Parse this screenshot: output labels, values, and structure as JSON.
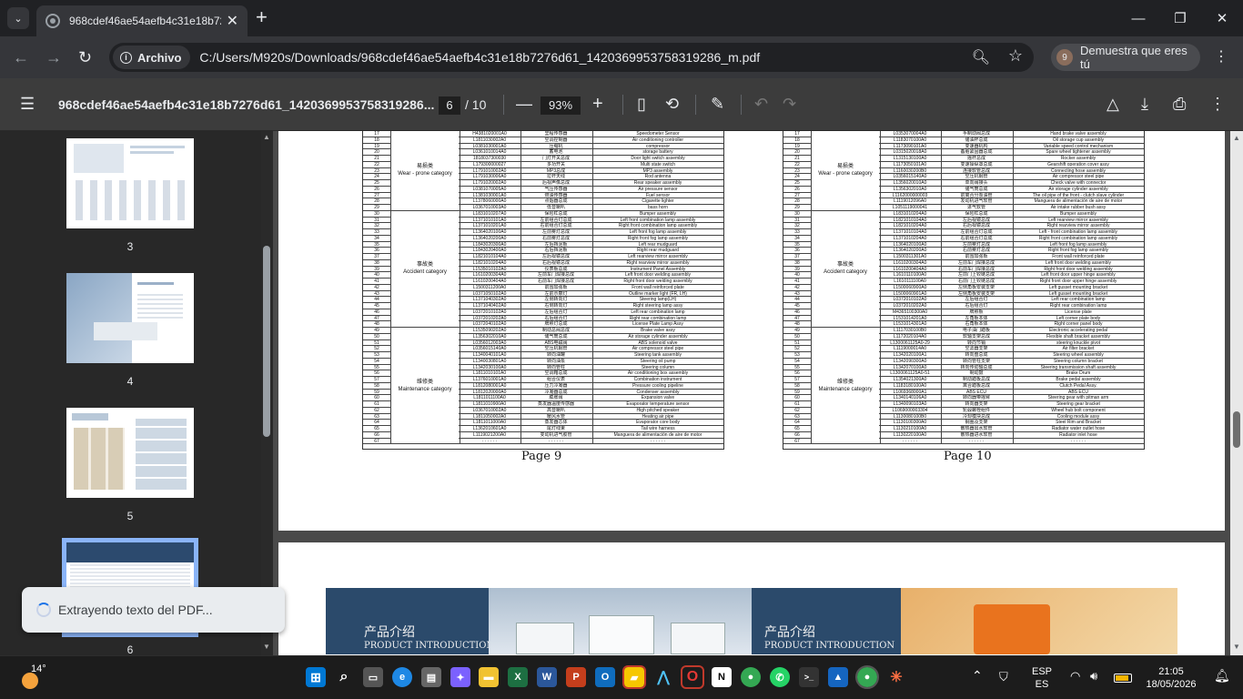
{
  "browser": {
    "tab_title": "968cdef46ae54aefb4c31e18b72",
    "address_chip": "Archivo",
    "url": "C:/Users/M920s/Downloads/968cdef46ae54aefb4c31e18b7276d61_1420369953758319286_m.pdf",
    "profile_label": "Demuestra que eres tú",
    "profile_initial": "9"
  },
  "pdf_toolbar": {
    "title": "968cdef46ae54aefb4c31e18b7276d61_1420369953758319286...",
    "current_page": "6",
    "total_pages": "/ 10",
    "zoom": "93%"
  },
  "thumbnails": [
    {
      "number": "3",
      "selected": false
    },
    {
      "number": "4",
      "selected": false
    },
    {
      "number": "5",
      "selected": false
    },
    {
      "number": "6",
      "selected": true
    }
  ],
  "toast": {
    "text": "Extrayendo texto del PDF..."
  },
  "page9": {
    "label": "Page  9",
    "categories": [
      {
        "zh": "易损类",
        "en": "Wear - prone category"
      },
      {
        "zh": "事故类",
        "en": "Accident category"
      },
      {
        "zh": "维修类",
        "en": "Maintenance category"
      }
    ],
    "rows": [
      [
        "17",
        "H4381020001A0",
        "里程传感器",
        "Speedometer Sensor"
      ],
      [
        "18",
        "L1811030002A0",
        "空调控制器",
        "Air conditioning controller"
      ],
      [
        "19",
        "L0381030001A0",
        "压缩机",
        "compressor"
      ],
      [
        "20",
        "L0361010014A0",
        "蓄电池",
        "storage battery"
      ],
      [
        "21",
        "1818037300030",
        "门灯开关总成",
        "Door light switch assembly"
      ],
      [
        "22",
        "L179300000027",
        "多功开关",
        "Multi state switch"
      ],
      [
        "23",
        "L1791010002A0",
        "MP3总成",
        "MP3 assembly"
      ],
      [
        "24",
        "L1791030006A0",
        "拉杆天线",
        "Rod antenna"
      ],
      [
        "25",
        "L1791020002A0",
        "后视声像总成",
        "Rear speaker assembly"
      ],
      [
        "26",
        "L0381070005A0",
        "气压传感器",
        "Air pressure sensor"
      ],
      [
        "27",
        "L1381030001A0",
        "燃油传感器",
        "Fuel sensor"
      ],
      [
        "28",
        "L1378060000A0",
        "点烟器总成",
        "Cigarette lighter"
      ],
      [
        "29",
        "L0367010003A0",
        "低音喇叭",
        "bass horn"
      ],
      [
        "30",
        "L1831010207A0",
        "保险杠总成",
        "Bumper assembly"
      ],
      [
        "31",
        "L1371010101A0",
        "左前组合灯总成",
        "Left front combination lamp assembly"
      ],
      [
        "32",
        "L1371010201A0",
        "右前组合灯总成",
        "Right front combination lamp assembly"
      ],
      [
        "33",
        "L1364020100A0",
        "左前雾灯总成",
        "Left front fog lamp assembly"
      ],
      [
        "34",
        "L1364020200A0",
        "右前雾灯总成",
        "Right front fog lamp assembly"
      ],
      [
        "35",
        "L1843020300A0",
        "左后挡泥板",
        "Left rear mudguard"
      ],
      [
        "36",
        "L1843020400A0",
        "右后挡泥板",
        "Right rear mudguard"
      ],
      [
        "37",
        "L1821010104A0",
        "左后视镜总成",
        "Left rearview mirror assembly"
      ],
      [
        "38",
        "L1821010204A0",
        "右后视镜总成",
        "Right rearview mirror assembly"
      ],
      [
        "39",
        "L1535010102A0",
        "仪表板总成",
        "Instrument Panel Assembly"
      ],
      [
        "40",
        "L1610200304A0",
        "左前车门焊接总成",
        "Left front door welding assembly"
      ],
      [
        "41",
        "L1610200404A0",
        "右前车门焊接总成",
        "Right front door welding assembly"
      ],
      [
        "42",
        "L1500311200A0",
        "前围加强板",
        "Front wall reinforced plate"
      ],
      [
        "43",
        "L0371050102A0",
        "左前示廓灯",
        "Outline marker light (FR, LH)"
      ],
      [
        "44",
        "L1371040302A0",
        "左侧转向灯",
        "Steering lamp(LH)"
      ],
      [
        "45",
        "L1371040402A0",
        "右侧转向灯",
        "Right steering lamp assy"
      ],
      [
        "46",
        "L0372010102A0",
        "左后组合灯",
        "Left rear combination lamp"
      ],
      [
        "47",
        "L0372010202A0",
        "右后组合灯",
        "Right rear combination lamp"
      ],
      [
        "48",
        "L0372040102A0",
        "牌照灯总成",
        "License Plate Lamp Assy"
      ],
      [
        "49",
        "L1535090202A0",
        "制动总阀总成",
        "Brake valve assy"
      ],
      [
        "50",
        "L1356302010A0",
        "储气筒总成",
        "Air storage cylinder assembly"
      ],
      [
        "51",
        "L0356012003A0",
        "ABS电磁阀",
        "ABS solenoid valve"
      ],
      [
        "52",
        "L0356015140A0",
        "空压机钢管",
        "Air compressor steel pipe"
      ],
      [
        "53",
        "L1340040101A0",
        "转向油罐",
        "Steering tank assembly"
      ],
      [
        "54",
        "L1340030801A0",
        "转向油泵",
        "Steering oil pump"
      ],
      [
        "55",
        "L1342030100A0",
        "转向管柱",
        "Steering column"
      ],
      [
        "56",
        "L1811010101A0",
        "空调箱总成",
        "Air conditioning box assembly"
      ],
      [
        "57",
        "L1376010001A0",
        "组合仪表",
        "Combination instrument"
      ],
      [
        "58",
        "L1812080001A0",
        "压力冷凝器",
        "Pressure cooling pipeline"
      ],
      [
        "59",
        "L1812020000A0",
        "冷凝器总成",
        "Condenser assembly"
      ],
      [
        "60",
        "L1811011100A0",
        "膨胀阀",
        "Expansion valve"
      ],
      [
        "61",
        "L1811010900A0",
        "蒸发器温度传感器",
        "Evaporator temperature sensor"
      ],
      [
        "62",
        "L0367010002A0",
        "高音喇叭",
        "High pitched speaker"
      ],
      [
        "63",
        "L1811050002A0",
        "暖风水管",
        "Heating air pipe"
      ],
      [
        "64",
        "L1811011000A0",
        "蒸发器芯体",
        "Evaporator core body"
      ],
      [
        "65",
        "L1362010601A0",
        "尾灯线束",
        "Tail wire harness"
      ],
      [
        "66",
        "L1119021200A0",
        "变动机进气胶管",
        "Manguera de alimentación de aire de motor"
      ],
      [
        "67",
        "· · · · · ·",
        "· · · · · ·",
        "· · · · · ·"
      ]
    ]
  },
  "page10": {
    "label": "Page  10",
    "categories": [
      {
        "zh": "易损类",
        "en": "Wear - prone category"
      },
      {
        "zh": "事故类",
        "en": "Accident category"
      },
      {
        "zh": "维修类",
        "en": "Maintenance category"
      }
    ],
    "rows": [
      [
        "17",
        "L0353070004A0",
        "手制动阀总成",
        "Hand brake valve assembly"
      ],
      [
        "18",
        "L1183070100A0",
        "储油杯总成",
        "Oil storage cup assembly"
      ],
      [
        "19",
        "L1173090101A0",
        "变速器机构",
        "Variable speed control mechanism"
      ],
      [
        "20",
        "L0315020018A0",
        "备胎紧固器总成",
        "Spare wheel tightener assembly"
      ],
      [
        "21",
        "L1315130100A0",
        "摇杆总成",
        "Rocker assembly"
      ],
      [
        "22",
        "L1173050101A0",
        "变速操纵罩总成",
        "Gearshift operation cover assy"
      ],
      [
        "23",
        "L1160030200B0",
        "连接软管总成",
        "Connecting hose assembly"
      ],
      [
        "24",
        "L0356015140A0",
        "空压机钢管",
        "Air compressor steel pipe"
      ],
      [
        "25",
        "L1356020010A0",
        "单向阀接头",
        "Check valve with connector"
      ],
      [
        "26",
        "L1356302010A0",
        "储气筒总成",
        "Air storage cylinder assembly"
      ],
      [
        "27",
        "L1162000000003",
        "前离合分泵油管",
        "The oil pipe of the front - clutch slave cylinder"
      ],
      [
        "28",
        "L1119012096A0",
        "发动机进气软管",
        "Manguera de alimentación de aire de motor"
      ],
      [
        "29",
        "L1051119000041",
        "进气软管",
        "Air intake rubber bush assy"
      ],
      [
        "30",
        "L1831010204A0",
        "保险杠总成",
        "Bumper assembly"
      ],
      [
        "31",
        "L1821010104A0",
        "左后视镜总成",
        "Left rearview mirror assembly"
      ],
      [
        "32",
        "L1821010204A0",
        "右后视镜总成",
        "Right rearview mirror assembly"
      ],
      [
        "33",
        "L1371010104A0",
        "左前组合灯总成",
        "Left - front combination lamp assembly"
      ],
      [
        "34",
        "L1371010204A0",
        "右前组合灯总成",
        "Right front combination lamp assembly"
      ],
      [
        "35",
        "L1364020100A0",
        "左前雾灯总成",
        "Left front fog lamp assembly"
      ],
      [
        "36",
        "L1364020200A0",
        "右前雾灯总成",
        "Right front fog lamp assembly"
      ],
      [
        "37",
        "L1500311301A0",
        "前围加强板",
        "Front wall reinforced plate"
      ],
      [
        "38",
        "L1610200304A0",
        "左前车门焊接总成",
        "Left front door welding assembly"
      ],
      [
        "39",
        "L1610200404A0",
        "右前车门焊接总成",
        "Right front door welding assembly"
      ],
      [
        "40",
        "L1610110100A0",
        "左前门上铰链总成",
        "Left front door upper hinge assembly"
      ],
      [
        "41",
        "L1610111100A0",
        "右前门上铰链总成",
        "Right front door upper hinge assembly"
      ],
      [
        "42",
        "L1500060900A0",
        "左侧角板安装支架",
        "Left gusset mounting bracket"
      ],
      [
        "43",
        "L1500060901A0",
        "左侧角板安装支架",
        "Left gusset mounting bracket"
      ],
      [
        "44",
        "L0372010102A0",
        "左后组合灯",
        "Left rear combination lamp"
      ],
      [
        "45",
        "L0372010202A0",
        "右后组合灯",
        "Right rear combination lamp"
      ],
      [
        "46",
        "M4365100300A0",
        "牌照板",
        "License plate"
      ],
      [
        "47",
        "L1531014201A0",
        "左角板本体",
        "Left corner plate body"
      ],
      [
        "48",
        "L1531014301A0",
        "右角板本体",
        "Right corner panel body"
      ],
      [
        "49",
        "L1117030100B0",
        "电子油门踏板",
        "Electronic accelerating pedal"
      ],
      [
        "50",
        "L1172020104A0",
        "软轴支架总成",
        "Flexible shaft bracket assembly"
      ],
      [
        "51",
        "L1300061125A0-29",
        "转向节销",
        "steering knuckle pivot"
      ],
      [
        "52",
        "L1119000014A0",
        "空滤器支架",
        "Air filter bracket"
      ],
      [
        "53",
        "L1342020100A1",
        "转向盘总成",
        "Steering wheel assembly"
      ],
      [
        "54",
        "L1342090300A0",
        "转向管柱支架",
        "Steering column bracket"
      ],
      [
        "55",
        "L1342070100A0",
        "转向传动轴总成",
        "Steering transmission shaft assembly"
      ],
      [
        "56",
        "L1300061125A0-51",
        "制动鼓",
        "Brake Drum"
      ],
      [
        "57",
        "L1354021300A0",
        "制动踏板总成",
        "Brake pedal assembly"
      ],
      [
        "58",
        "L1183180100A0",
        "离合踏板总成",
        "Clutch Pedal Assy."
      ],
      [
        "59",
        "L1069368000A1",
        "ABS ECU",
        "ABS ECU"
      ],
      [
        "60",
        "L1340140106A0",
        "转向器带摇臂",
        "Steering gear with pitman arm"
      ],
      [
        "61",
        "L1340090103A0",
        "转向器支架",
        "Steering gear bracket"
      ],
      [
        "62",
        "L1069000003304",
        "轮毂螺栓组件",
        "Wheel hub bolt component"
      ],
      [
        "63",
        "L1130080100B0",
        "冷却模块总成",
        "Cooling module assy"
      ],
      [
        "64",
        "L1130100300A0",
        "钢圈及支架",
        "Steel Rim and Bracket"
      ],
      [
        "65",
        "L1130210100A0",
        "散热器出水软管",
        "Radiator water outlet hose"
      ],
      [
        "66",
        "L1130220100A0",
        "散热器进水软管",
        "Radiator inlet hose"
      ],
      [
        "67",
        "· · · · · ·",
        "· · · · · ·",
        "· · · · · ·"
      ]
    ]
  },
  "banner": {
    "zh": "产品介绍",
    "en": "PRODUCT INTRODUCTION"
  },
  "taskbar": {
    "temperature": "14°",
    "lang_top": "ESP",
    "lang_bottom": "ES",
    "time": "21:05",
    "date": "18/05/2026"
  }
}
